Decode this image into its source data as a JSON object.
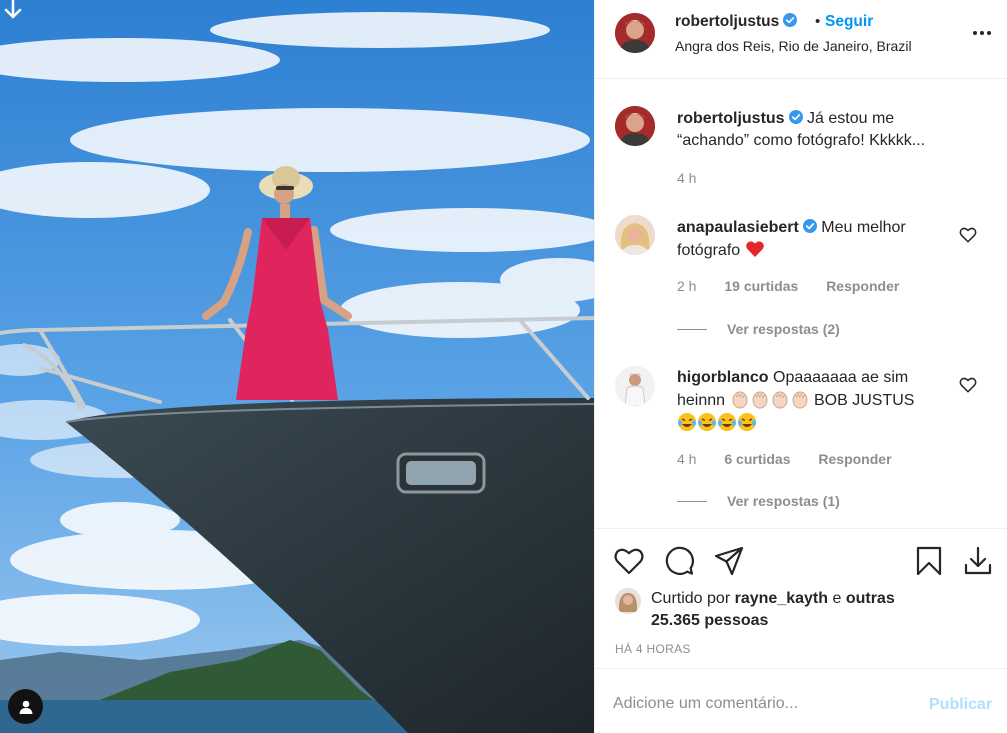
{
  "post": {
    "photo_alt": "",
    "icons": {
      "top": "arrow-down-icon",
      "user_tag": "user-tag-icon"
    }
  },
  "header": {
    "username": "robertoljustus",
    "verified": true,
    "separator": "•",
    "follow_label": "Seguir",
    "location": "Angra dos Reis, Rio de Janeiro, Brazil",
    "more_icon": "more-options-icon"
  },
  "caption": {
    "username": "robertoljustus",
    "text": "Já estou me “achando” como fotógrafo! Kkkkk...",
    "time": "4 h"
  },
  "comments": [
    {
      "username": "anapaulasiebert",
      "verified": true,
      "text": "Meu melhor fotógrafo",
      "emoji": "red-heart",
      "time": "2 h",
      "likes": "19 curtidas",
      "reply_label": "Responder",
      "view_replies": "Ver respostas (2)"
    },
    {
      "username": "higorblanco",
      "verified": false,
      "text_before": "Opaaaaaaa ae sim heinnn",
      "text_after": "BOB JUSTUS",
      "emojis_clap": 4,
      "emojis_laugh": 4,
      "time": "4 h",
      "likes": "6 curtidas",
      "reply_label": "Responder",
      "view_replies": "Ver respostas (1)"
    }
  ],
  "actions": {
    "like_icon": "heart-icon",
    "comment_icon": "comment-icon",
    "share_icon": "share-icon",
    "save_icon": "bookmark-icon",
    "download_icon": "download-icon"
  },
  "likes": {
    "prefix": "Curtido por",
    "user": "rayne_kayth",
    "conjunction": "e",
    "others": "outras 25.365 pessoas"
  },
  "timestamp": "HÁ 4 HORAS",
  "add_comment": {
    "placeholder": "Adicione um comentário...",
    "publish_label": "Publicar"
  },
  "colors": {
    "accent": "#0095f6",
    "publish_disabled": "#b2dffc",
    "secondary_text": "#8e8e8e",
    "heart_red": "#ed4956",
    "dress": "#e0245e"
  }
}
